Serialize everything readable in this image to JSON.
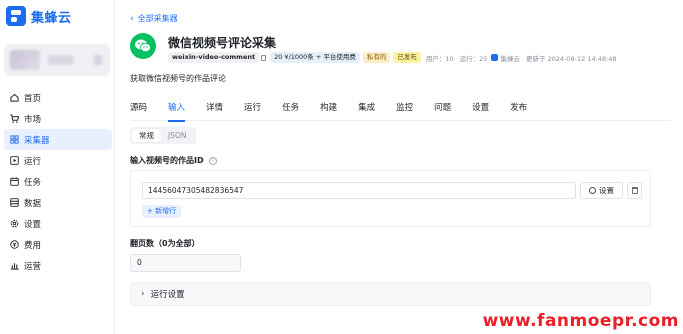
{
  "brand": {
    "name": "集蜂云"
  },
  "sidebar": {
    "items": [
      {
        "label": "首页",
        "icon": "home-icon",
        "active": false
      },
      {
        "label": "市场",
        "icon": "cart-icon",
        "active": false
      },
      {
        "label": "采集器",
        "icon": "grid-icon",
        "active": true
      },
      {
        "label": "运行",
        "icon": "play-icon",
        "active": false
      },
      {
        "label": "任务",
        "icon": "calendar-icon",
        "active": false
      },
      {
        "label": "数据",
        "icon": "database-icon",
        "active": false
      },
      {
        "label": "设置",
        "icon": "gear-icon",
        "active": false
      },
      {
        "label": "费用",
        "icon": "coin-icon",
        "active": false
      },
      {
        "label": "运营",
        "icon": "chart-icon",
        "active": false
      }
    ]
  },
  "header": {
    "back_label": "全部采集器",
    "title": "微信视频号评论采集",
    "slug": "weixin-video-comment",
    "price": "20 ¥/1000条 + 平台使用费",
    "private_badge": "私有的",
    "published_badge": "已发布",
    "users": "用户：10",
    "runs": "运行：25",
    "author": "集蜂云",
    "updated": "更新于 2024-08-12 14:48:48",
    "description": "获取微信视频号的作品评论"
  },
  "tabs": [
    "源码",
    "输入",
    "详情",
    "运行",
    "任务",
    "构建",
    "集成",
    "监控",
    "问题",
    "设置",
    "发布"
  ],
  "active_tab": 1,
  "input_mode": {
    "options": [
      "常规",
      "JSON"
    ],
    "active": 0
  },
  "form": {
    "id_label": "输入视频号的作品ID",
    "id_value": "14456047305482836547",
    "settings_label": "设置",
    "add_row_label": "+ 新增行",
    "pages_label": "翻页数（0为全部）",
    "pages_value": "0",
    "run_settings_label": "运行设置"
  },
  "watermark": "www.fanmoepr.com",
  "colors": {
    "accent": "#1d6cf0",
    "wechat_green": "#07c160",
    "watermark": "#e8202a"
  }
}
